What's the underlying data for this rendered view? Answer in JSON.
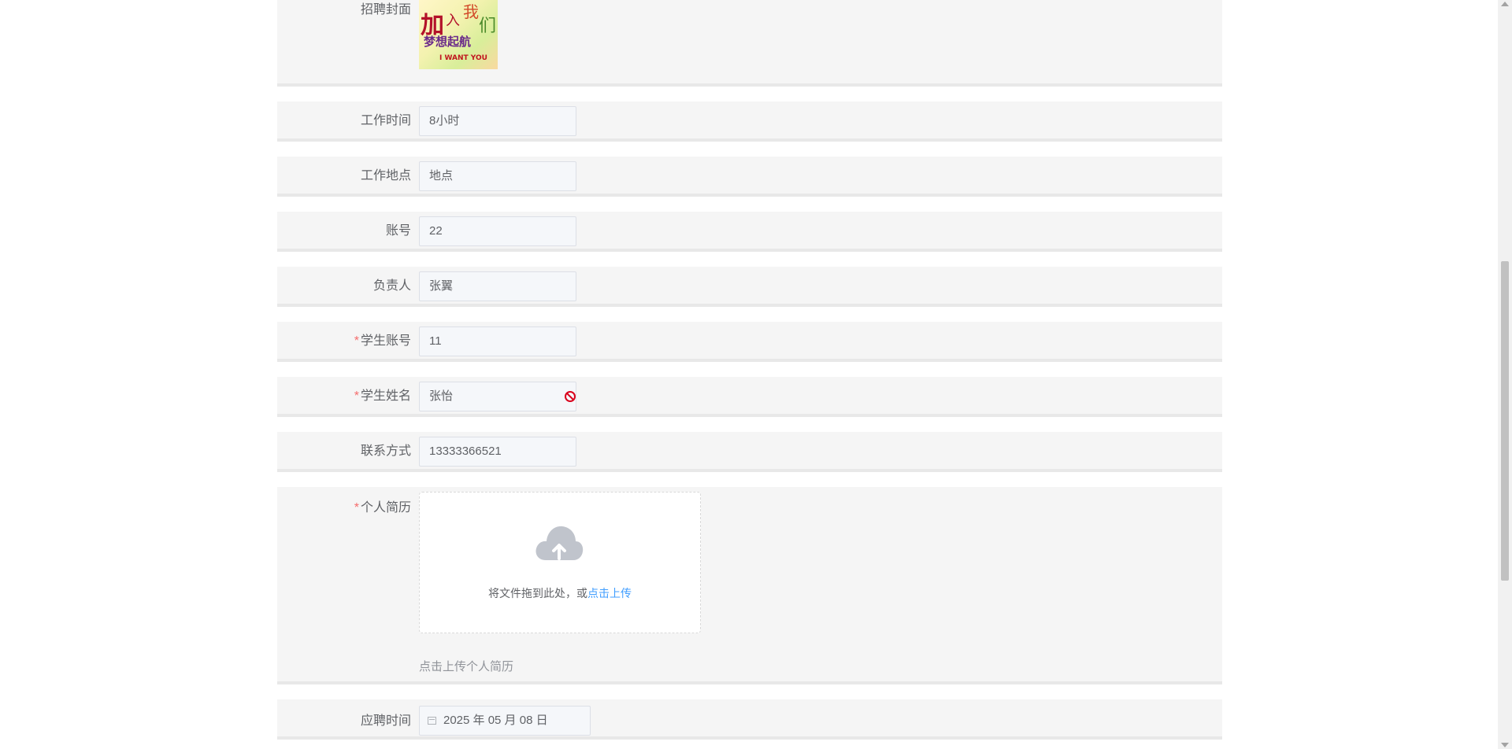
{
  "form": {
    "cover": {
      "label": "招聘封面",
      "image_text_top": "加入我们",
      "image_text_mid": "梦想起航",
      "image_text_bottom": "I WANT YOU"
    },
    "work_time": {
      "label": "工作时间",
      "value": "8小时"
    },
    "work_place": {
      "label": "工作地点",
      "value": "地点"
    },
    "account": {
      "label": "账号",
      "value": "22"
    },
    "manager": {
      "label": "负责人",
      "value": "张翼"
    },
    "student_account": {
      "required": "*",
      "label": "学生账号",
      "value": "11"
    },
    "student_name": {
      "required": "*",
      "label": "学生姓名",
      "value": "张怡"
    },
    "contact": {
      "label": "联系方式",
      "value": "13333366521"
    },
    "resume": {
      "required": "*",
      "label": "个人简历",
      "drop_text": "将文件拖到此处，或",
      "upload_link": "点击上传",
      "tip": "点击上传个人简历"
    },
    "apply_time": {
      "label": "应聘时间",
      "value": "2025 年 05 月 08 日"
    }
  },
  "colors": {
    "required": "#f56c6c",
    "link": "#409eff",
    "row_bg": "#f5f5f5",
    "forbidden_icon": "#d9001b"
  },
  "icons": [
    "cloud-upload-icon",
    "calendar-icon",
    "forbidden-icon"
  ]
}
